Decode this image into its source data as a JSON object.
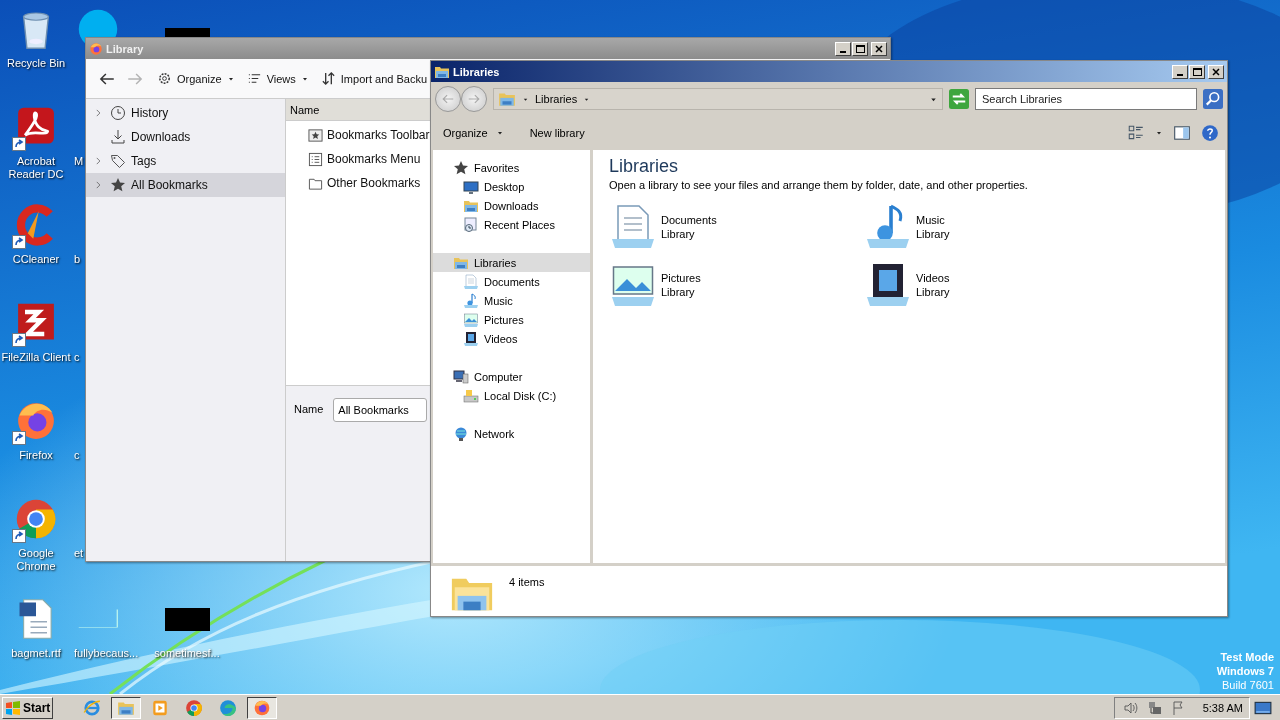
{
  "desktop": {
    "columns": [
      [
        {
          "label": "Recycle Bin",
          "kind": "recycle",
          "shortcut": false
        },
        {
          "label": "Acrobat Reader DC",
          "kind": "acrobat",
          "shortcut": true
        },
        {
          "label": "CCleaner",
          "kind": "ccleaner",
          "shortcut": true
        },
        {
          "label": "FileZilla Client",
          "kind": "filezilla",
          "shortcut": true
        },
        {
          "label": "Firefox",
          "kind": "firefox",
          "shortcut": true
        },
        {
          "label": "Google Chrome",
          "kind": "chrome",
          "shortcut": true
        },
        {
          "label": "bagmet.rtf",
          "kind": "word",
          "shortcut": false
        }
      ],
      [
        {
          "kind": "skype"
        },
        {
          "label": "M",
          "kind": "none"
        },
        {
          "label": "b",
          "kind": "none"
        },
        {
          "label": "c",
          "kind": "none"
        },
        {
          "label": "c",
          "kind": "none"
        },
        {
          "label": "et",
          "kind": "none"
        },
        {
          "label": "fullybecaus...",
          "kind": "blank"
        }
      ],
      [
        {
          "kind": "black"
        },
        {
          "kind": "none"
        },
        {
          "kind": "none"
        },
        {
          "kind": "none"
        },
        {
          "kind": "none"
        },
        {
          "kind": "none"
        },
        {
          "label": "sometimesf...",
          "kind": "black"
        }
      ]
    ],
    "test_mode": [
      "Test Mode",
      "Windows 7",
      "Build 7601"
    ]
  },
  "library_window": {
    "title": "Library",
    "nav": [
      {
        "kind": "back",
        "disabled": false
      },
      {
        "kind": "forward",
        "disabled": true
      }
    ],
    "toolbar": [
      {
        "kind": "gear",
        "label": "Organize",
        "menu": true
      },
      {
        "kind": "list",
        "label": "Views",
        "menu": true
      },
      {
        "kind": "sort",
        "label": "Import and Backu",
        "menu": false
      }
    ],
    "sidebar": [
      {
        "label": "History",
        "kind": "clock",
        "expandable": true,
        "selected": false
      },
      {
        "label": "Downloads",
        "kind": "download",
        "expandable": false,
        "selected": false
      },
      {
        "label": "Tags",
        "kind": "tag",
        "expandable": true,
        "selected": false
      },
      {
        "label": "All Bookmarks",
        "kind": "star",
        "expandable": true,
        "selected": true
      }
    ],
    "column": "Name",
    "rows": [
      {
        "label": "Bookmarks Toolbar",
        "kind": "starbox"
      },
      {
        "label": "Bookmarks Menu",
        "kind": "menulist"
      },
      {
        "label": "Other Bookmarks",
        "kind": "folder"
      }
    ],
    "name_field": {
      "label": "Name",
      "value": "All Bookmarks"
    }
  },
  "libraries_window": {
    "title": "Libraries",
    "nav": [
      {
        "kind": "back",
        "disabled": true
      },
      {
        "kind": "forward",
        "disabled": true
      }
    ],
    "address": "Libraries",
    "search": {
      "placeholder": "Search Libraries"
    },
    "commands": [
      {
        "label": "Organize",
        "menu": true
      },
      {
        "label": "New library",
        "menu": false
      }
    ],
    "sidebar": [
      {
        "label": "Favorites",
        "kind": "star",
        "selected": false,
        "children": [
          {
            "label": "Desktop",
            "kind": "desktop",
            "selected": false
          },
          {
            "label": "Downloads",
            "kind": "downloads",
            "selected": false
          },
          {
            "label": "Recent Places",
            "kind": "recent",
            "selected": false
          }
        ]
      },
      {
        "label": "Libraries",
        "kind": "libraries",
        "selected": true,
        "children": [
          {
            "label": "Documents",
            "kind": "documents",
            "selected": false
          },
          {
            "label": "Music",
            "kind": "music",
            "selected": false
          },
          {
            "label": "Pictures",
            "kind": "pictures",
            "selected": false
          },
          {
            "label": "Videos",
            "kind": "videos",
            "selected": false
          }
        ]
      },
      {
        "label": "Computer",
        "kind": "computer",
        "selected": false,
        "children": [
          {
            "label": "Local Disk (C:)",
            "kind": "disk",
            "selected": false
          }
        ]
      },
      {
        "label": "Network",
        "kind": "network",
        "selected": false
      }
    ],
    "heading": "Libraries",
    "description": "Open a library to see your files and arrange them by folder, date, and other properties.",
    "items": [
      {
        "name": "Documents",
        "sub": "Library",
        "kind": "documents"
      },
      {
        "name": "Music",
        "sub": "Library",
        "kind": "music"
      },
      {
        "name": "Pictures",
        "sub": "Library",
        "kind": "pictures"
      },
      {
        "name": "Videos",
        "sub": "Library",
        "kind": "videos"
      }
    ],
    "details": "4 items"
  },
  "taskbar": {
    "start": "Start",
    "apps": [
      {
        "kind": "ie",
        "running": false
      },
      {
        "kind": "explorer",
        "running": true
      },
      {
        "kind": "media",
        "running": false
      },
      {
        "kind": "chrome",
        "running": false
      },
      {
        "kind": "edge",
        "running": false
      },
      {
        "kind": "firefox",
        "running": true
      }
    ],
    "tray": [
      {
        "kind": "volume"
      },
      {
        "kind": "nettray"
      },
      {
        "kind": "flag"
      }
    ],
    "clock": "5:38 AM"
  }
}
